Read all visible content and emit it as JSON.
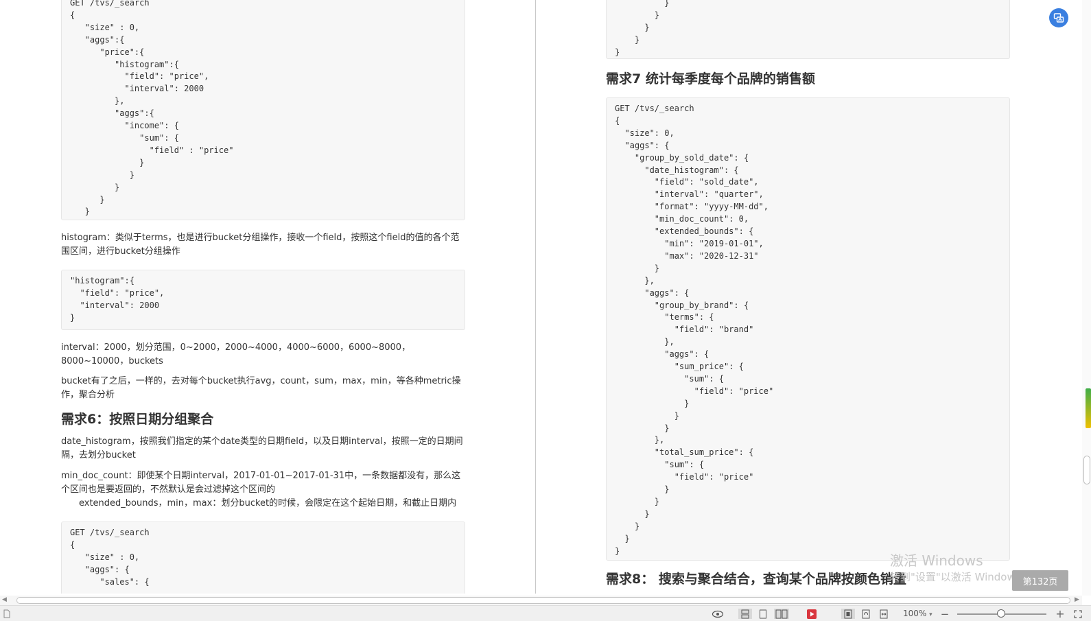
{
  "left_column": {
    "code_block_1": "GET /tvs/_search\n{\n   \"size\" : 0,\n   \"aggs\":{\n      \"price\":{\n         \"histogram\":{\n           \"field\": \"price\",\n           \"interval\": 2000\n         },\n         \"aggs\":{\n           \"income\": {\n              \"sum\": {\n                \"field\" : \"price\"\n              }\n            }\n         }\n      }\n   }\n}",
    "para_histogram": "histogram：类似于terms，也是进行bucket分组操作，接收一个field，按照这个field的值的各个范围区间，进行bucket分组操作",
    "code_block_2": "\"histogram\":{\n  \"field\": \"price\",\n  \"interval\": 2000\n}",
    "para_interval": "interval：2000，划分范围，0~2000，2000~4000，4000~6000，6000~8000，8000~10000，buckets",
    "para_bucket": "bucket有了之后，一样的，去对每个bucket执行avg，count，sum，max，min，等各种metric操作，聚合分析",
    "heading_6": "需求6：按照日期分组聚合",
    "para_date_histogram": "date_histogram，按照我们指定的某个date类型的日期field，以及日期interval，按照一定的日期间隔，去划分bucket",
    "para_min_doc_count": "min_doc_count：即使某个日期interval，2017-01-01~2017-01-31中，一条数据都没有，那么这个区间也是要返回的，不然默认是会过滤掉这个区间的",
    "para_extended_bounds": "extended_bounds，min，max：划分bucket的时候，会限定在这个起始日期，和截止日期内",
    "code_block_3": "GET /tvs/_search\n{\n   \"size\" : 0,\n   \"aggs\": {\n      \"sales\": {"
  },
  "right_column": {
    "code_block_1": "          }\n        }\n      }\n    }\n}",
    "heading_7": "需求7 统计每季度每个品牌的销售额",
    "code_block_2": "GET /tvs/_search\n{\n  \"size\": 0,\n  \"aggs\": {\n    \"group_by_sold_date\": {\n      \"date_histogram\": {\n        \"field\": \"sold_date\",\n        \"interval\": \"quarter\",\n        \"format\": \"yyyy-MM-dd\",\n        \"min_doc_count\": 0,\n        \"extended_bounds\": {\n          \"min\": \"2019-01-01\",\n          \"max\": \"2020-12-31\"\n        }\n      },\n      \"aggs\": {\n        \"group_by_brand\": {\n          \"terms\": {\n            \"field\": \"brand\"\n          },\n          \"aggs\": {\n            \"sum_price\": {\n              \"sum\": {\n                \"field\": \"price\"\n              }\n            }\n          }\n        },\n        \"total_sum_price\": {\n          \"sum\": {\n            \"field\": \"price\"\n          }\n        }\n      }\n    }\n  }\n}",
    "heading_8": "需求8： 搜索与聚合结合，查询某个品牌按颜色销量"
  },
  "watermark": {
    "line1": "激活 Windows",
    "line2": "转到\"设置\"以激活 Windows。"
  },
  "page_indicator": "第132页",
  "statusbar": {
    "zoom_label": "100%",
    "zoom_caret": "▾",
    "minus": "−",
    "plus": "+"
  },
  "icons": {
    "float_button": "translate-icon",
    "status": [
      "eye-icon",
      "page-view-icon",
      "single-page-icon",
      "double-page-icon",
      "play-icon",
      "fit-page-icon",
      "rotate-icon",
      "fit-width-icon",
      "fullscreen-icon"
    ]
  },
  "colors": {
    "accent": "#3a7fe0",
    "play": "#d9363e",
    "code_bg": "#f7f7f7"
  }
}
